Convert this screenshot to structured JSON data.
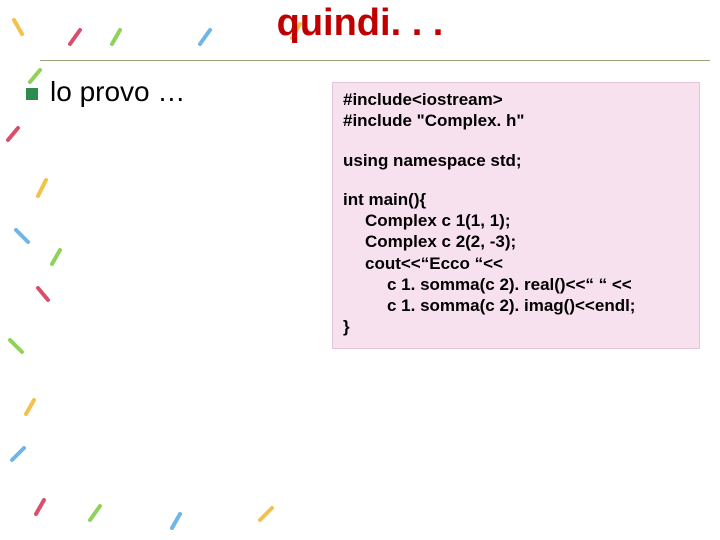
{
  "title": "quindi. . .",
  "bullet": "lo provo …",
  "code": {
    "l1": "#include<iostream>",
    "l2": "#include \"Complex. h\"",
    "l3": "using namespace std;",
    "l4": "int main(){",
    "l5": "Complex c 1(1, 1);",
    "l6": "Complex c 2(2, -3);",
    "l7": "cout<<“Ecco “<<",
    "l8": "c 1. somma(c 2). real()<<“ “ <<",
    "l9": "c 1. somma(c 2). imag()<<endl;",
    "l10": "}"
  }
}
